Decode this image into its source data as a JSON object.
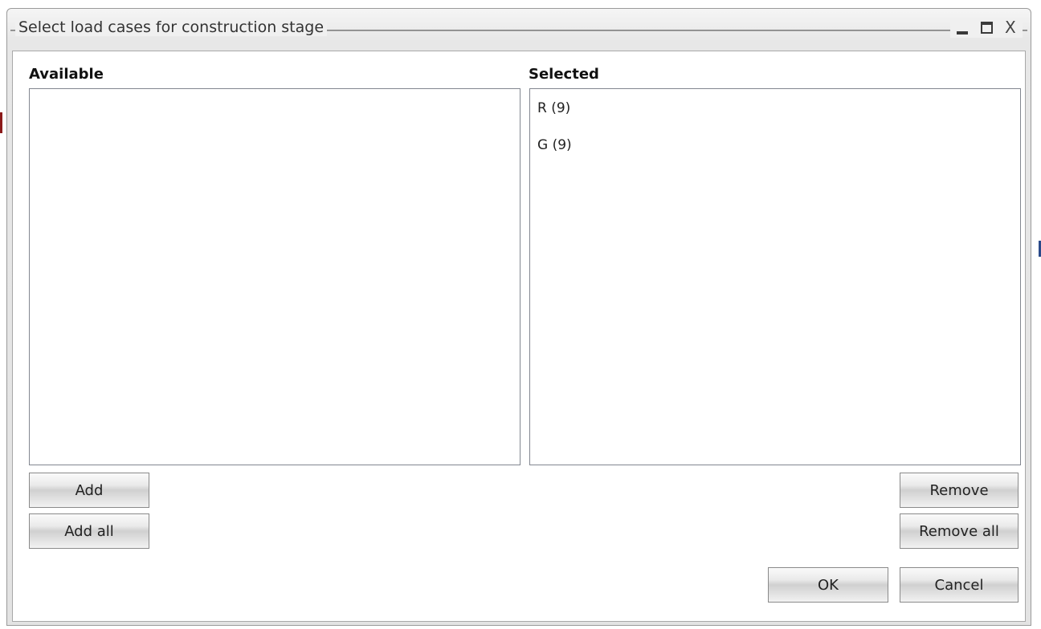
{
  "window": {
    "title": "Select load cases for construction stage",
    "controls": {
      "minimize": "minimize-icon",
      "maximize": "maximize-icon",
      "close_glyph": "X"
    }
  },
  "available": {
    "label": "Available",
    "items": []
  },
  "selected": {
    "label": "Selected",
    "items": [
      "R (9)",
      "G (9)"
    ]
  },
  "buttons": {
    "add": "Add",
    "add_all": "Add all",
    "remove": "Remove",
    "remove_all": "Remove all",
    "ok": "OK",
    "cancel": "Cancel"
  }
}
